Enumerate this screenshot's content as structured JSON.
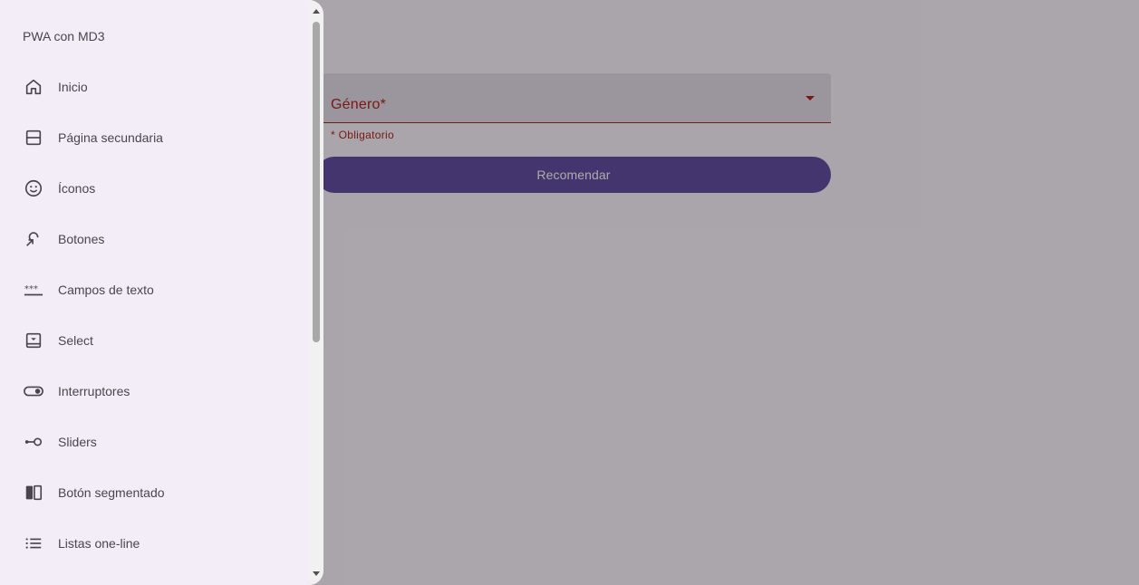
{
  "drawer": {
    "title": "PWA con MD3",
    "items": [
      {
        "label": "Inicio",
        "icon": "home-icon"
      },
      {
        "label": "Página secundaria",
        "icon": "split-page-icon"
      },
      {
        "label": "Íconos",
        "icon": "smiley-icon"
      },
      {
        "label": "Botones",
        "icon": "touch-app-icon"
      },
      {
        "label": "Campos de texto",
        "icon": "password-field-icon"
      },
      {
        "label": "Select",
        "icon": "select-box-icon"
      },
      {
        "label": "Interruptores",
        "icon": "toggle-icon"
      },
      {
        "label": "Sliders",
        "icon": "slider-icon"
      },
      {
        "label": "Botón segmentado",
        "icon": "segmented-icon"
      },
      {
        "label": "Listas one-line",
        "icon": "list-icon"
      }
    ]
  },
  "form": {
    "select_label": "Género*",
    "helper_text": "* Obligatorio",
    "submit_label": "Recomendar"
  },
  "colors": {
    "error": "#b3261e",
    "primary": "#6750a4",
    "drawer_bg": "#f3edf7"
  }
}
